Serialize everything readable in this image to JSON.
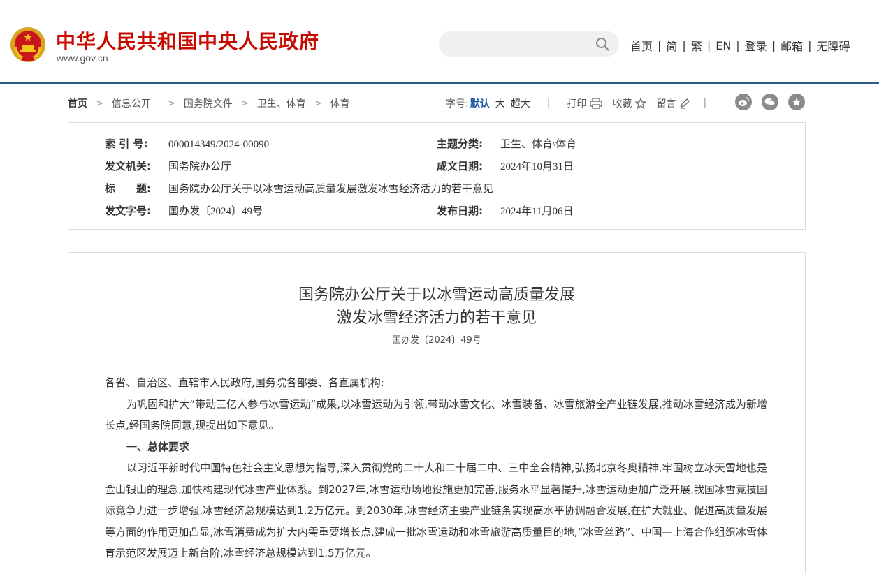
{
  "header": {
    "site_title": "中华人民共和国中央人民政府",
    "site_url": "www.gov.cn",
    "search_placeholder": "",
    "nav": [
      "首页",
      "简",
      "繁",
      "EN",
      "登录",
      "邮箱",
      "无障碍"
    ],
    "colors": {
      "brand_red": "#c60a00",
      "divider_blue": "#2e5c8a"
    }
  },
  "breadcrumb": [
    "首页",
    "信息公开",
    "国务院文件",
    "卫生、体育",
    "体育"
  ],
  "tools": {
    "font_label": "字号:",
    "font_default": "默认",
    "font_large": "大",
    "font_xlarge": "超大",
    "print": "打印",
    "favorite": "收藏",
    "comment": "留言"
  },
  "share_icons": [
    "weibo-icon",
    "wechat-icon",
    "favorites-icon"
  ],
  "meta": {
    "index_label": "索 引 号:",
    "index_value": "000014349/2024-00090",
    "topic_label": "主题分类:",
    "topic_value": "卫生、体育\\体育",
    "issuer_label": "发文机关:",
    "issuer_value": "国务院办公厅",
    "created_label": "成文日期:",
    "created_value": "2024年10月31日",
    "title_label": "标　　题:",
    "title_value": "国务院办公厅关于以冰雪运动高质量发展激发冰雪经济活力的若干意见",
    "docno_label": "发文字号:",
    "docno_value": "国办发〔2024〕49号",
    "published_label": "发布日期:",
    "published_value": "2024年11月06日"
  },
  "document": {
    "title_line1": "国务院办公厅关于以冰雪运动高质量发展",
    "title_line2": "激发冰雪经济活力的若干意见",
    "doc_number": "国办发〔2024〕49号",
    "salutation": "各省、自治区、直辖市人民政府,国务院各部委、各直属机构:",
    "para1": "为巩固和扩大“带动三亿人参与冰雪运动”成果,以冰雪运动为引领,带动冰雪文化、冰雪装备、冰雪旅游全产业链发展,推动冰雪经济成为新增长点,经国务院同意,现提出如下意见。",
    "section1": "一、总体要求",
    "para2": "以习近平新时代中国特色社会主义思想为指导,深入贯彻党的二十大和二十届二中、三中全会精神,弘扬北京冬奥精神,牢固树立冰天雪地也是金山银山的理念,加快构建现代冰雪产业体系。到2027年,冰雪运动场地设施更加完善,服务水平显著提升,冰雪运动更加广泛开展,我国冰雪竞技国际竞争力进一步增强,冰雪经济总规模达到1.2万亿元。到2030年,冰雪经济主要产业链条实现高水平协调融合发展,在扩大就业、促进高质量发展等方面的作用更加凸显,冰雪消费成为扩大内需重要增长点,建成一批冰雪运动和冰雪旅游高质量目的地,“冰雪丝路”、中国—上海合作组织冰雪体育示范区发展迈上新台阶,冰雪经济总规模达到1.5万亿元。"
  }
}
